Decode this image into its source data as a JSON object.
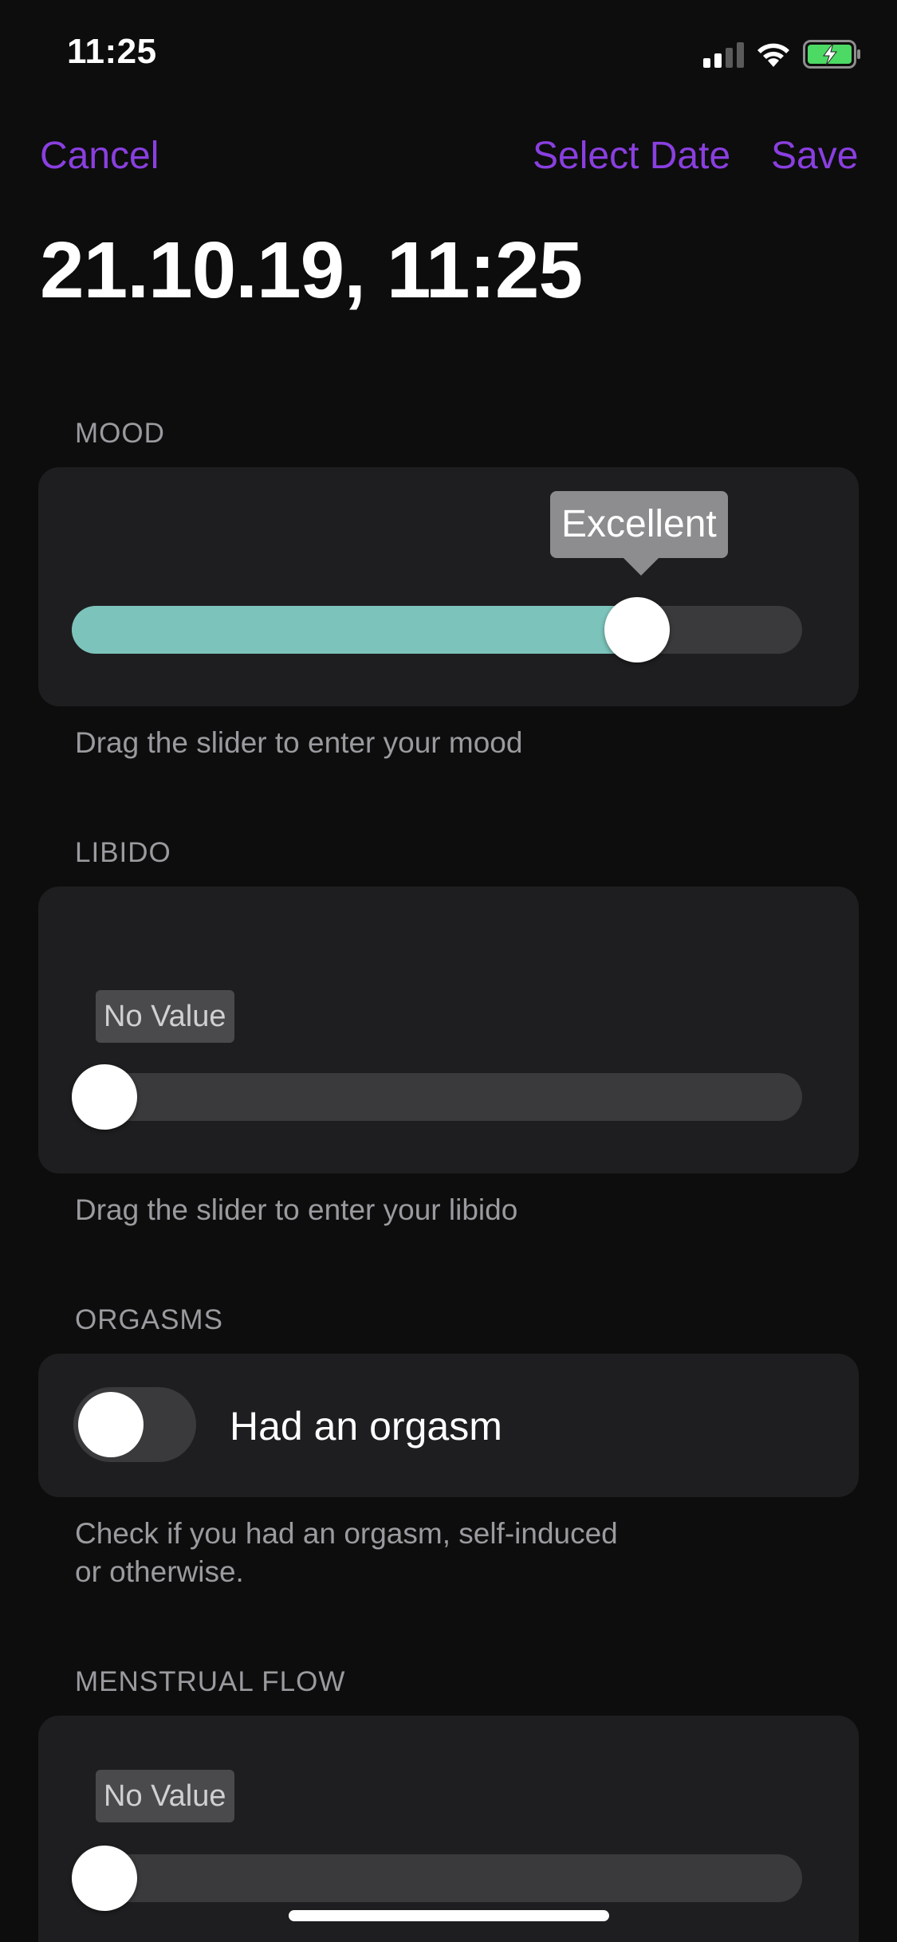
{
  "status_bar": {
    "time": "11:25"
  },
  "nav": {
    "cancel": "Cancel",
    "select_date": "Select Date",
    "save": "Save"
  },
  "title": "21.10.19, 11:25",
  "mood": {
    "header": "MOOD",
    "value_label": "Excellent",
    "level": 0.775,
    "footnote": "Drag the slider to enter your mood"
  },
  "libido": {
    "header": "LIBIDO",
    "value_label": "No Value",
    "level": 0,
    "footnote": "Drag the slider to enter your libido"
  },
  "orgasms": {
    "header": "ORGASMS",
    "toggle_label": "Had an orgasm",
    "toggle_on": false,
    "footnote_line1": "Check if you had an orgasm, self-induced",
    "footnote_line2": "or otherwise."
  },
  "menstrual_flow": {
    "header": "MENSTRUAL FLOW",
    "value_label": "No Value",
    "level": 0
  },
  "colors": {
    "accent": "#8a3fe0",
    "mood_fill": "#7cc4bb",
    "battery_fill": "#4cd964"
  },
  "icons": [
    "cellular-signal-icon",
    "wifi-icon",
    "battery-charging-icon"
  ]
}
